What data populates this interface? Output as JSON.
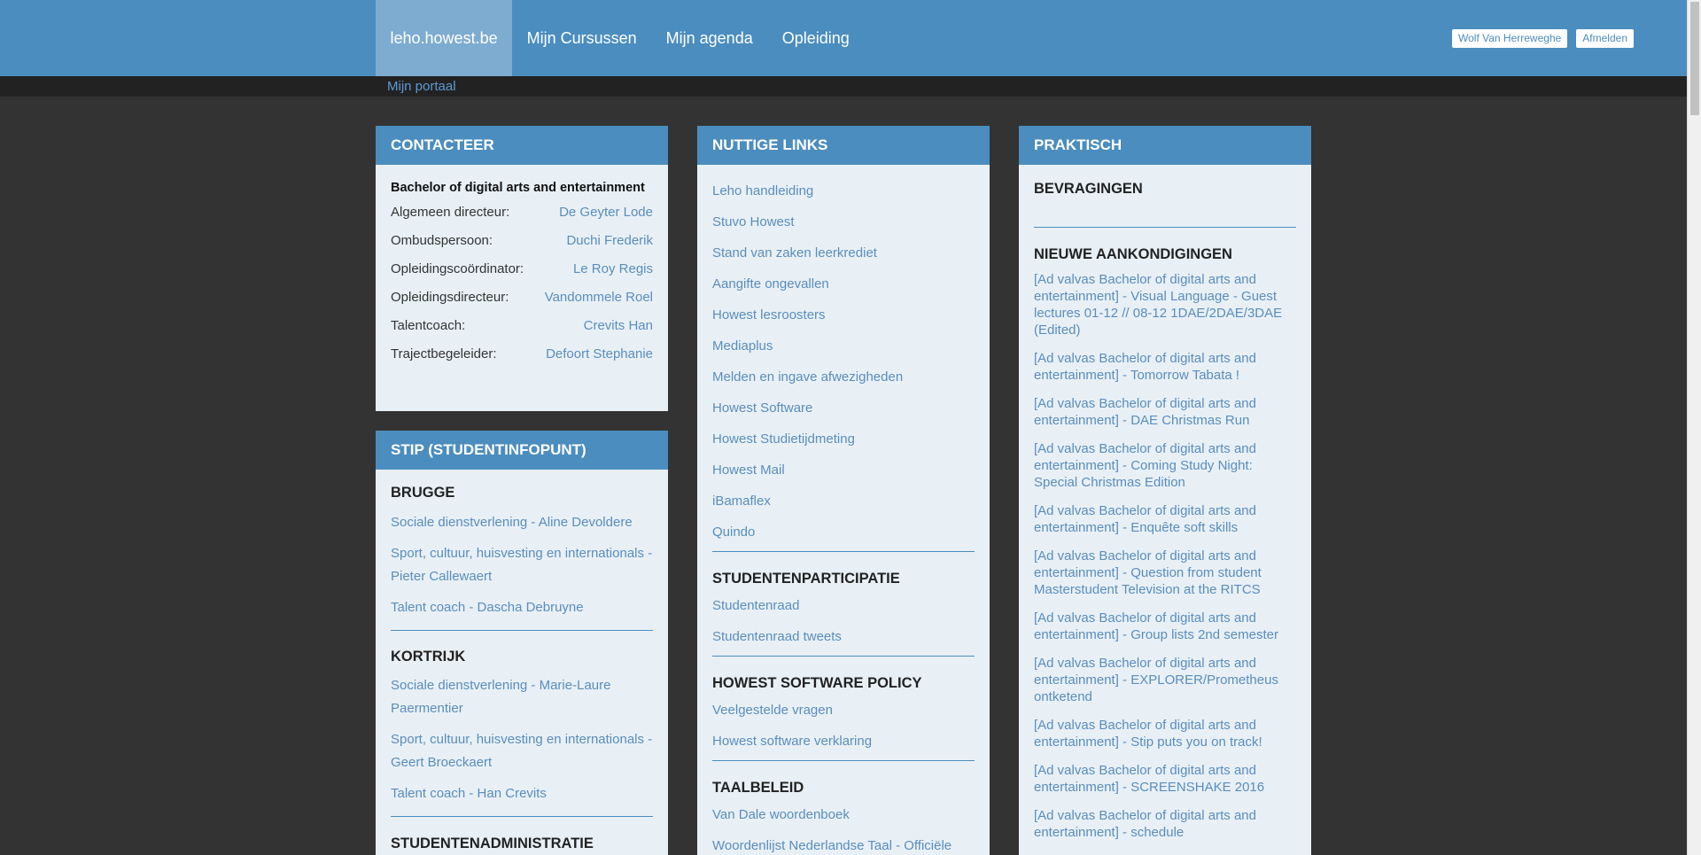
{
  "nav": {
    "items": [
      {
        "label": "leho.howest.be",
        "active": true
      },
      {
        "label": "Mijn Cursussen",
        "active": false
      },
      {
        "label": "Mijn agenda",
        "active": false
      },
      {
        "label": "Opleiding",
        "active": false
      }
    ],
    "user_name": "Wolf Van Herreweghe",
    "logout_label": "Afmelden"
  },
  "breadcrumb": "Mijn portaal",
  "contact": {
    "title": "CONTACTEER",
    "org": "Bachelor of digital arts and entertainment",
    "rows": [
      {
        "label": "Algemeen directeur:",
        "value": "De Geyter Lode"
      },
      {
        "label": "Ombudspersoon:",
        "value": "Duchi Frederik"
      },
      {
        "label": "Opleidingscoördinator:",
        "value": "Le Roy Regis"
      },
      {
        "label": "Opleidingsdirecteur:",
        "value": "Vandommele Roel"
      },
      {
        "label": "Talentcoach:",
        "value": "Crevits Han"
      },
      {
        "label": "Trajectbegeleider:",
        "value": "Defoort Stephanie"
      }
    ]
  },
  "stip": {
    "title": "STIP (STUDENTINFOPUNT)",
    "brugge": {
      "title": "BRUGGE",
      "links": [
        "Sociale dienstverlening - Aline Devoldere",
        "Sport, cultuur, huisvesting en internationals - Pieter Callewaert",
        "Talent coach - Dascha Debruyne"
      ]
    },
    "kortrijk": {
      "title": "KORTRIJK",
      "links": [
        "Sociale dienstverlening - Marie-Laure Paermentier",
        "Sport, cultuur, huisvesting en internationals - Geert Broeckaert",
        "Talent coach - Han Crevits"
      ]
    },
    "admin_title": "STUDENTENADMINISTRATIE"
  },
  "links": {
    "title": "NUTTIGE LINKS",
    "items": [
      "Leho handleiding",
      "Stuvo Howest",
      "Stand van zaken leerkrediet",
      "Aangifte ongevallen",
      "Howest lesroosters",
      "Mediaplus",
      "Melden en ingave afwezigheden",
      "Howest Software",
      "Howest Studietijdmeting",
      "Howest Mail",
      "iBamaflex",
      "Quindo"
    ],
    "participatie": {
      "title": "STUDENTENPARTICIPATIE",
      "items": [
        "Studentenraad",
        "Studentenraad tweets"
      ]
    },
    "software_policy": {
      "title": "HOWEST SOFTWARE POLICY",
      "items": [
        "Veelgestelde vragen",
        "Howest software verklaring"
      ]
    },
    "taalbeleid": {
      "title": "TAALBELEID",
      "items": [
        "Van Dale woordenboek",
        "Woordenlijst Nederlandse Taal - Officiële"
      ]
    }
  },
  "praktisch": {
    "title": "PRAKTISCH",
    "bevragingen_title": "BEVRAGINGEN",
    "announcements_title": "NIEUWE AANKONDIGINGEN",
    "announcements": [
      "[Ad valvas Bachelor of digital arts and entertainment] - Visual Language - Guest lectures 01-12 // 08-12 1DAE/2DAE/3DAE (Edited)",
      "[Ad valvas Bachelor of digital arts and entertainment] - Tomorrow Tabata !",
      "[Ad valvas Bachelor of digital arts and entertainment] - DAE Christmas Run",
      "[Ad valvas Bachelor of digital arts and entertainment] - Coming Study Night: Special Christmas Edition",
      "[Ad valvas Bachelor of digital arts and entertainment] - Enquête soft skills",
      "[Ad valvas Bachelor of digital arts and entertainment] - Question from student Masterstudent Television at the RITCS",
      "[Ad valvas Bachelor of digital arts and entertainment] - Group lists 2nd semester",
      "[Ad valvas Bachelor of digital arts and entertainment] - EXPLORER/Prometheus ontketend",
      "[Ad valvas Bachelor of digital arts and entertainment] - Stip puts you on track!",
      "[Ad valvas Bachelor of digital arts and entertainment] - SCREENSHAKE 2016",
      "[Ad valvas Bachelor of digital arts and entertainment] - schedule"
    ]
  }
}
